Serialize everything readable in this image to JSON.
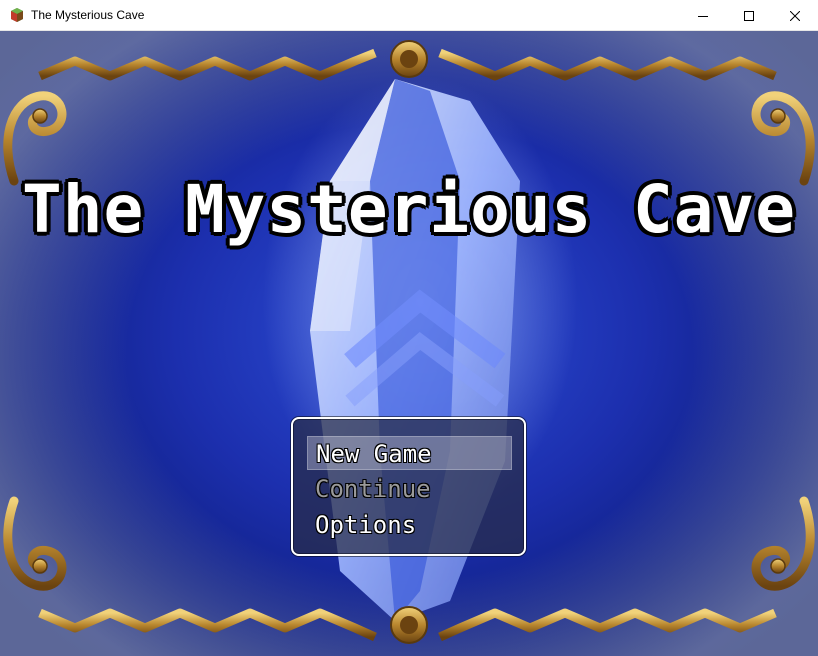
{
  "window": {
    "title": "The Mysterious Cave",
    "controls": [
      "minimize",
      "maximize",
      "close"
    ]
  },
  "game": {
    "title": "The Mysterious Cave",
    "menu": [
      {
        "label": "New Game",
        "state": "selected"
      },
      {
        "label": "Continue",
        "state": "disabled"
      },
      {
        "label": "Options",
        "state": "enabled"
      }
    ]
  },
  "colors": {
    "background_blue": "#1c2fae",
    "frame_gold": "#b8862e",
    "menu_window": "#282c46"
  }
}
